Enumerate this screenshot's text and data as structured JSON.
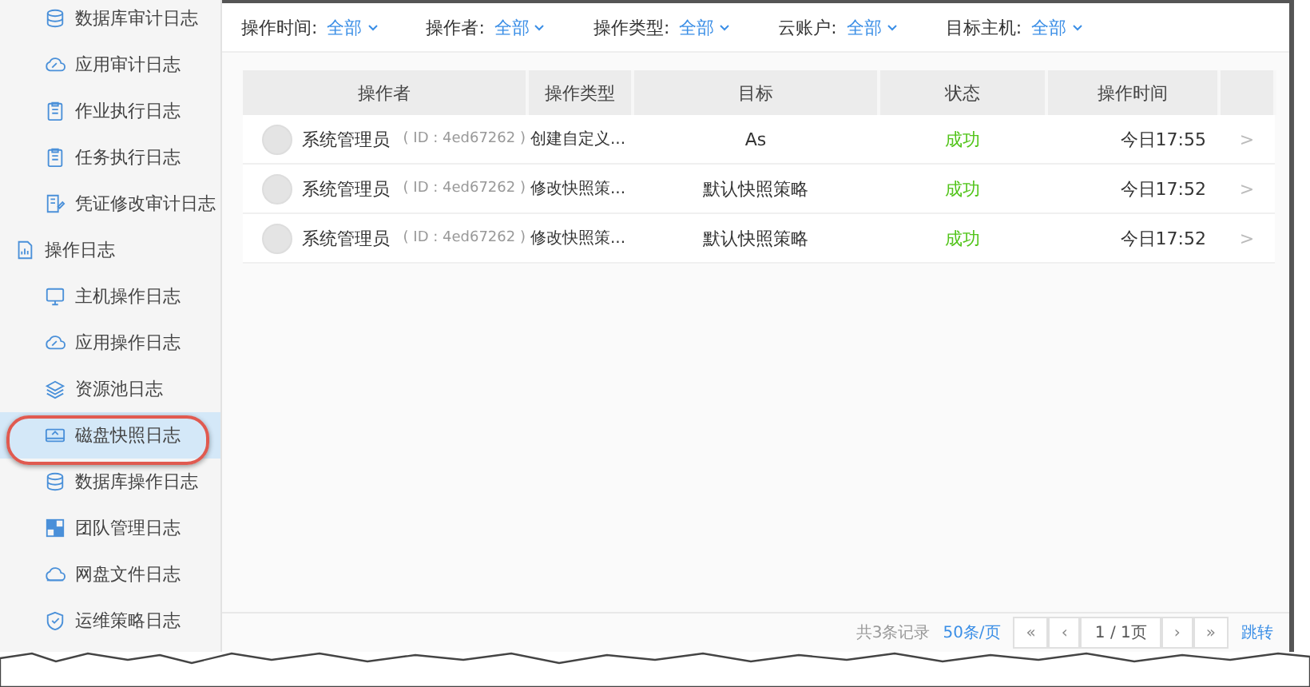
{
  "sidebar": {
    "sections": [
      {
        "children": [
          {
            "label": "数据库审计日志",
            "selected": false
          },
          {
            "label": "应用审计日志",
            "selected": false
          },
          {
            "label": "作业执行日志",
            "selected": false
          },
          {
            "label": "任务执行日志",
            "selected": false
          },
          {
            "label": "凭证修改审计日志",
            "selected": false
          }
        ]
      },
      {
        "label": "操作日志",
        "children": [
          {
            "label": "主机操作日志",
            "selected": false
          },
          {
            "label": "应用操作日志",
            "selected": false
          },
          {
            "label": "资源池日志",
            "selected": false
          },
          {
            "label": "磁盘快照日志",
            "selected": true
          },
          {
            "label": "数据库操作日志",
            "selected": false
          },
          {
            "label": "团队管理日志",
            "selected": false
          },
          {
            "label": "网盘文件日志",
            "selected": false
          },
          {
            "label": "运维策略日志",
            "selected": false
          }
        ]
      }
    ]
  },
  "filters": [
    {
      "label": "操作时间:",
      "value": "全部"
    },
    {
      "label": "操作者:",
      "value": "全部"
    },
    {
      "label": "操作类型:",
      "value": "全部"
    },
    {
      "label": "云账户:",
      "value": "全部"
    },
    {
      "label": "目标主机:",
      "value": "全部"
    }
  ],
  "table": {
    "columns": [
      "操作者",
      "操作类型",
      "目标",
      "状态",
      "操作时间"
    ],
    "rows": [
      {
        "operator": "系统管理员",
        "id": "( ID : 4ed67262 )",
        "type": "创建自定义...",
        "target": "As",
        "status": "成功",
        "time": "今日17:55",
        "arrow": ">"
      },
      {
        "operator": "系统管理员",
        "id": "( ID : 4ed67262 )",
        "type": "修改快照策...",
        "target": "默认快照策略",
        "status": "成功",
        "time": "今日17:52",
        "arrow": ">"
      },
      {
        "operator": "系统管理员",
        "id": "( ID : 4ed67262 )",
        "type": "修改快照策...",
        "target": "默认快照策略",
        "status": "成功",
        "time": "今日17:52",
        "arrow": ">"
      }
    ]
  },
  "pagination": {
    "total": "共3条记录",
    "page_size": "50条/页",
    "first": "«",
    "prev": "‹",
    "page": "1 / 1页",
    "next": "›",
    "last": "»",
    "jump": "跳转"
  }
}
